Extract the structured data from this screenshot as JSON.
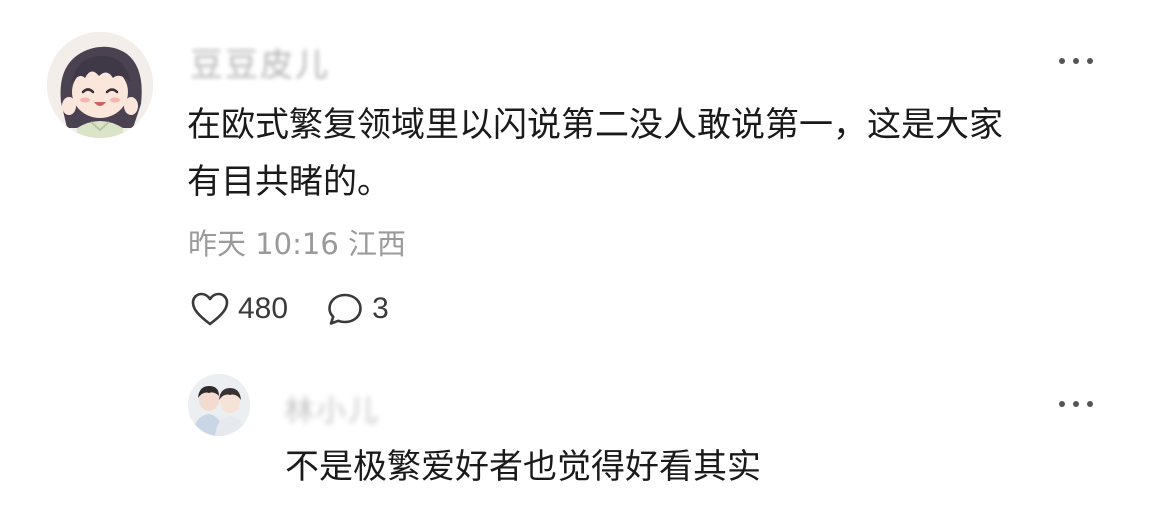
{
  "comment": {
    "username": "豆豆皮儿",
    "content_lines": [
      "在欧式繁复领域里以闪说第二没人敢说第一，这是大家",
      "有目共睹的。"
    ],
    "time": "昨天 10:16",
    "location": "江西",
    "likes": "480",
    "replies": "3",
    "avatar_icon": "anime-girl-avatar",
    "more_icon": "more-dots-icon"
  },
  "reply": {
    "username": "林小儿",
    "content": "不是极繁爱好者也觉得好看其实",
    "avatar_icon": "two-people-photo-avatar",
    "more_icon": "more-dots-icon"
  },
  "colors": {
    "text": "#1a1a1a",
    "meta": "#9a9a9a",
    "icon": "#3a3a3a"
  }
}
